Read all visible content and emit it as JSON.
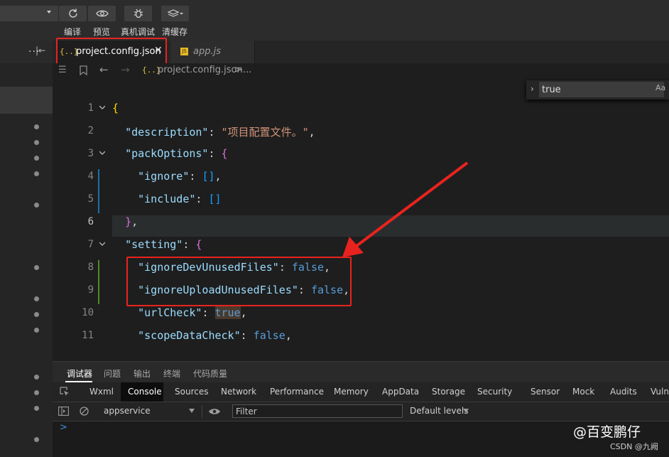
{
  "toolbar": {
    "buttons": [
      {
        "label": "编译",
        "icon": "refresh-icon"
      },
      {
        "label": "预览",
        "icon": "eye-icon"
      },
      {
        "label": "真机调试",
        "icon": "bug-icon"
      },
      {
        "label": "清缓存",
        "icon": "layers-icon"
      }
    ]
  },
  "tabs": [
    {
      "label": "project.config.json",
      "icon": "{..}",
      "active": true
    },
    {
      "label": "app.js",
      "icon": "JS",
      "active": false
    }
  ],
  "breadcrumb": {
    "icon": "{..}",
    "file": "project.config.json",
    "sep": ">",
    "rest": "..."
  },
  "tree": {
    "more": "..."
  },
  "find": {
    "value": "true",
    "match_case": "Aa"
  },
  "editor": {
    "current_line": 6,
    "lines": [
      {
        "n": "1",
        "tokens": [
          [
            "b1",
            "{"
          ]
        ]
      },
      {
        "n": "2",
        "tokens": [
          [
            "p",
            "  "
          ],
          [
            "k",
            "\"description\""
          ],
          [
            "p",
            ": "
          ],
          [
            "s",
            "\"项目配置文件。\""
          ],
          [
            "p",
            ","
          ]
        ]
      },
      {
        "n": "3",
        "tokens": [
          [
            "p",
            "  "
          ],
          [
            "k",
            "\"packOptions\""
          ],
          [
            "p",
            ": "
          ],
          [
            "b2",
            "{"
          ]
        ]
      },
      {
        "n": "4",
        "tokens": [
          [
            "p",
            "    "
          ],
          [
            "k",
            "\"ignore\""
          ],
          [
            "p",
            ": "
          ],
          [
            "b3",
            "[]"
          ],
          [
            "p",
            ","
          ]
        ]
      },
      {
        "n": "5",
        "tokens": [
          [
            "p",
            "    "
          ],
          [
            "k",
            "\"include\""
          ],
          [
            "p",
            ": "
          ],
          [
            "b3",
            "[]"
          ]
        ]
      },
      {
        "n": "6",
        "tokens": [
          [
            "p",
            "  "
          ],
          [
            "b2",
            "}"
          ],
          [
            "p",
            ","
          ]
        ]
      },
      {
        "n": "7",
        "tokens": [
          [
            "p",
            "  "
          ],
          [
            "k",
            "\"setting\""
          ],
          [
            "p",
            ": "
          ],
          [
            "b2",
            "{"
          ]
        ]
      },
      {
        "n": "8",
        "tokens": [
          [
            "p",
            "    "
          ],
          [
            "k",
            "\"ignoreDevUnusedFiles\""
          ],
          [
            "p",
            ": "
          ],
          [
            "kw",
            "false"
          ],
          [
            "p",
            ","
          ]
        ]
      },
      {
        "n": "9",
        "tokens": [
          [
            "p",
            "    "
          ],
          [
            "k",
            "\"ignoreUploadUnusedFiles\""
          ],
          [
            "p",
            ": "
          ],
          [
            "kw",
            "false"
          ],
          [
            "p",
            ","
          ]
        ]
      },
      {
        "n": "10",
        "tokens": [
          [
            "p",
            "    "
          ],
          [
            "k",
            "\"urlCheck\""
          ],
          [
            "p",
            ": "
          ],
          [
            "kw",
            "true"
          ],
          [
            "p",
            ","
          ]
        ]
      },
      {
        "n": "11",
        "tokens": [
          [
            "p",
            "    "
          ],
          [
            "k",
            "\"scopeDataCheck\""
          ],
          [
            "p",
            ": "
          ],
          [
            "kw",
            "false"
          ],
          [
            "p",
            ","
          ]
        ]
      }
    ]
  },
  "devtools": {
    "top_tabs": [
      "调试器",
      "问题",
      "输出",
      "终端",
      "代码质量"
    ],
    "panel_tabs": [
      "Wxml",
      "Console",
      "Sources",
      "Network",
      "Performance",
      "Memory",
      "AppData",
      "Storage",
      "Security",
      "Sensor",
      "Mock",
      "Audits",
      "Vulne"
    ],
    "active_panel": "Console",
    "context": "appservice",
    "filter_placeholder": "Filter",
    "levels": "Default levels",
    "prompt": ">"
  },
  "watermark": {
    "main": "@百变鹏仔",
    "sub": "CSDN @九阙"
  },
  "colors": {
    "highlight_box": "#e8231f",
    "keyword": "#569cd6",
    "key": "#9cdcfe",
    "string": "#ce9178"
  }
}
